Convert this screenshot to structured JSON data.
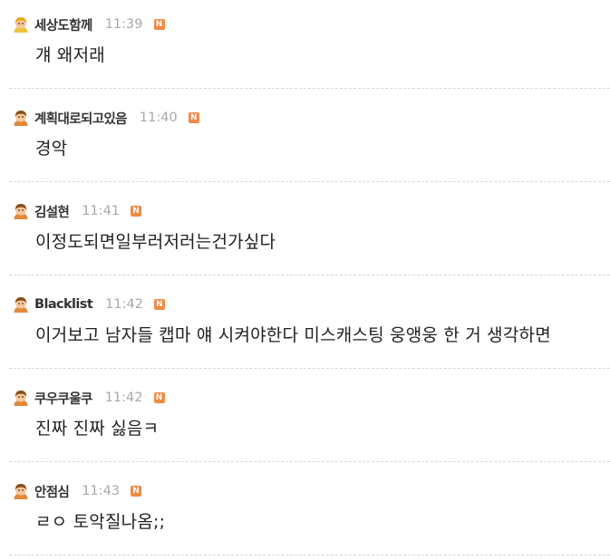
{
  "colors": {
    "badge": "#ef8b45",
    "timestamp": "#a8a8a8",
    "author": "#333333",
    "divider": "#d9d9d9"
  },
  "comments": [
    {
      "author": "세상도함께",
      "time": "11:39",
      "badge": "N",
      "text": "걔 왜저래",
      "avatar_icon": "yellow-user-icon"
    },
    {
      "author": "계획대로되고있음",
      "time": "11:40",
      "badge": "N",
      "text": "경악",
      "avatar_icon": "user-icon"
    },
    {
      "author": "김설현",
      "time": "11:41",
      "badge": "N",
      "text": "이정도되면일부러저러는건가싶다",
      "avatar_icon": "user-icon"
    },
    {
      "author": "Blacklist",
      "time": "11:42",
      "badge": "N",
      "text": "이거보고 남자들 캡마 얘 시켜야한다 미스캐스팅 웅앵웅 한 거 생각하면",
      "avatar_icon": "user-icon"
    },
    {
      "author": "쿠우쿠울쿠",
      "time": "11:42",
      "badge": "N",
      "text": "진짜 진짜 싫음ㅋ",
      "avatar_icon": "user-icon"
    },
    {
      "author": "안점심",
      "time": "11:43",
      "badge": "N",
      "text": "ㄹㅇ 토악질나옴;;",
      "avatar_icon": "user-icon"
    }
  ]
}
